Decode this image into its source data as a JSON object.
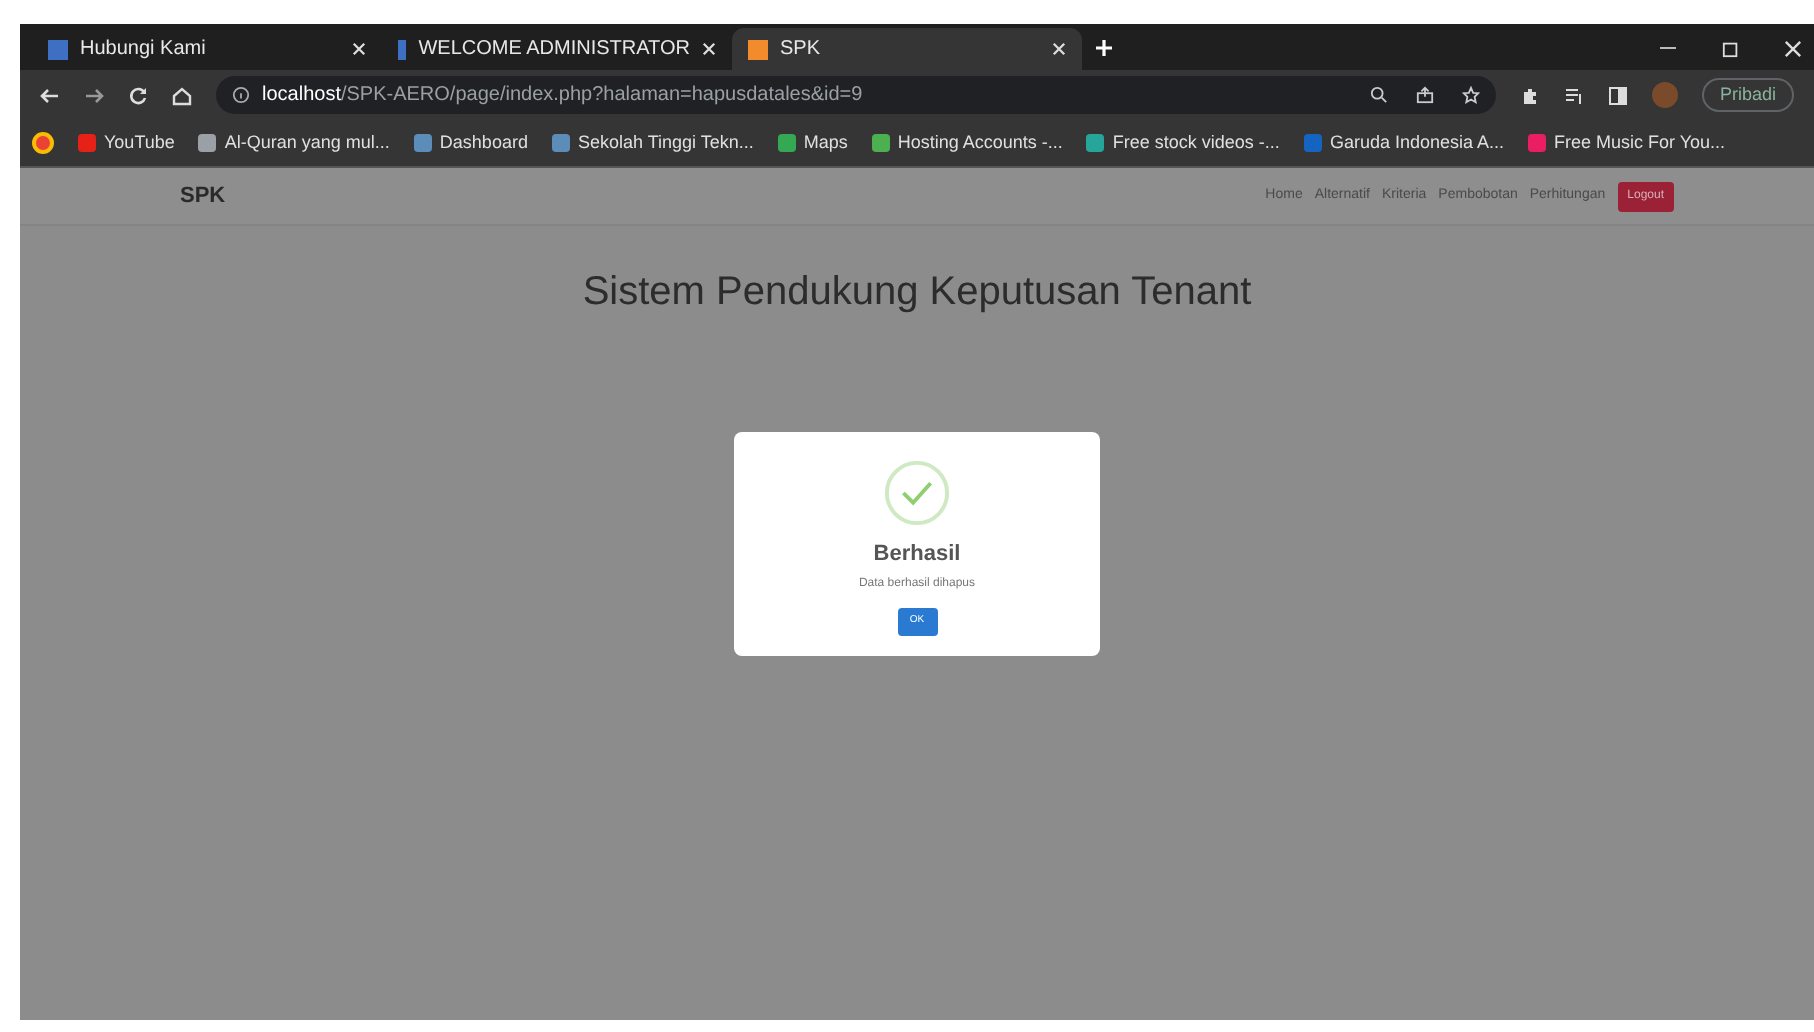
{
  "browser": {
    "tabs": [
      {
        "title": "Hubungi Kami",
        "selected": false
      },
      {
        "title": "WELCOME ADMINISTRATOR",
        "selected": false
      },
      {
        "title": "SPK",
        "selected": true
      }
    ],
    "address": {
      "host": "localhost",
      "path": "/SPK-AERO/page/index.php?halaman=hapusdatales&id=9"
    },
    "profile": "Pribadi",
    "bookmarks": [
      "YouTube",
      "Al-Quran yang mul...",
      "Dashboard",
      "Sekolah Tinggi Tekn...",
      "Maps",
      "Hosting Accounts -...",
      "Free stock videos -...",
      "Garuda Indonesia A...",
      "Free Music For You..."
    ]
  },
  "navbar": {
    "brand": "SPK",
    "links": [
      "Home",
      "Alternatif",
      "Kriteria",
      "Pembobotan",
      "Perhitungan"
    ],
    "logout": "Logout"
  },
  "page": {
    "title": "Sistem Pendukung Keputusan Tenant"
  },
  "dialog": {
    "title": "Berhasil",
    "message": "Data berhasil dihapus",
    "button": "OK"
  }
}
